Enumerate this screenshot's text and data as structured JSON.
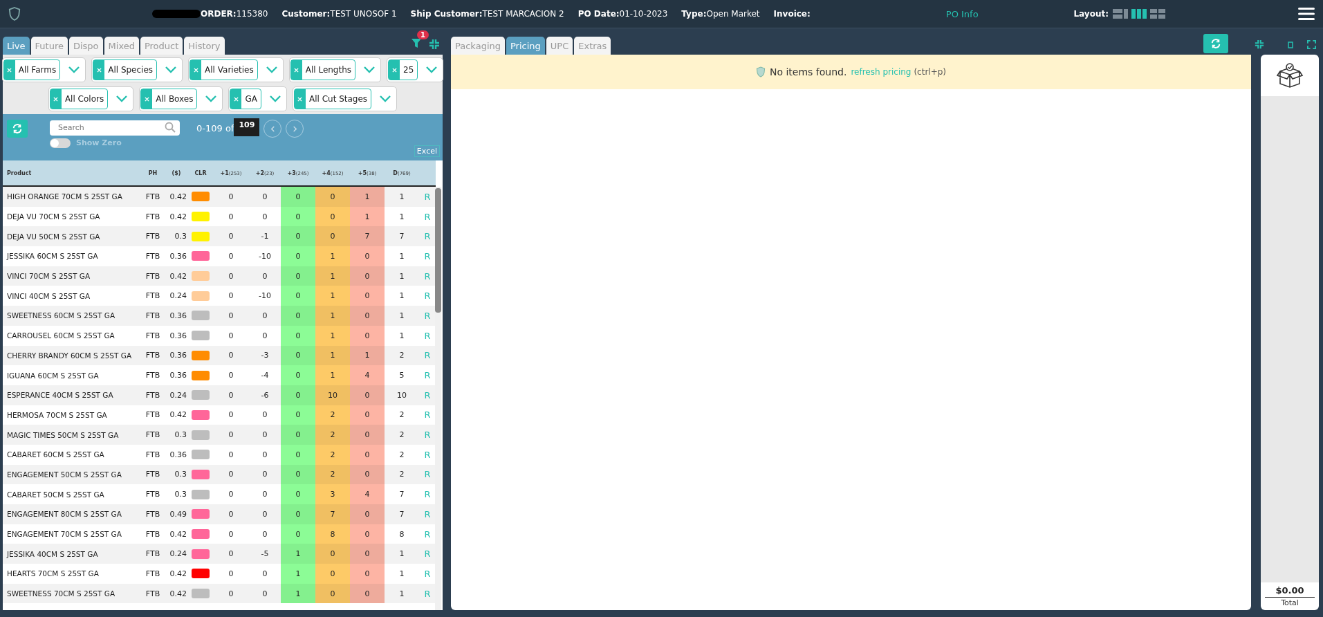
{
  "header": {
    "fields": [
      {
        "label": "ORDER:",
        "value": "115380"
      },
      {
        "label": "Customer:",
        "value": "TEST UNOSOF 1"
      },
      {
        "label": "Ship Customer:",
        "value": "TEST MARCACION 2"
      },
      {
        "label": "PO Date:",
        "value": "01-10-2023"
      },
      {
        "label": "Type:",
        "value": "Open Market"
      },
      {
        "label": "Invoice:"
      }
    ],
    "po_info": "PO Info",
    "layout_label": "Layout:",
    "layouts": [
      {
        "selected": false
      },
      {
        "selected": true
      },
      {
        "selected": false
      }
    ]
  },
  "left": {
    "tabs": [
      {
        "label": "Live",
        "selected": true
      },
      {
        "label": "Future",
        "selected": false
      },
      {
        "label": "Dispo",
        "selected": false
      },
      {
        "label": "Mixed",
        "selected": false
      },
      {
        "label": "Product",
        "selected": false
      },
      {
        "label": "History",
        "selected": false
      }
    ],
    "filter_badge": "1",
    "filters": [
      [
        "All Farms",
        "All Species",
        "All Varieties",
        "All Lengths",
        "25"
      ],
      [
        "All Colors",
        "All Boxes",
        "GA",
        "All Cut Stages"
      ]
    ],
    "search": {
      "placeholder": "Search"
    },
    "range": "0-109 of",
    "total": "109",
    "show_zero": {
      "label": "Show Zero",
      "on": false
    },
    "excel": "Excel",
    "columns": [
      {
        "label": "Product"
      },
      {
        "label": "PH"
      },
      {
        "label": "($)"
      },
      {
        "label": "CLR"
      },
      {
        "label": "+1",
        "count": "(253)"
      },
      {
        "label": "+2",
        "count": "(23)"
      },
      {
        "label": "+3",
        "count": "(245)"
      },
      {
        "label": "+4",
        "count": "(152)"
      },
      {
        "label": "+5",
        "count": "(38)"
      },
      {
        "label": "D",
        "count": "(769)"
      }
    ],
    "rows": [
      {
        "product": "HIGH ORANGE 70CM S 25ST GA",
        "ph": "FTB",
        "price": "0.42",
        "color": "#ff8c00",
        "d1": "0",
        "d2": "0",
        "d3": "0",
        "d4": "0",
        "d5": "1",
        "d": "1",
        "action": "R"
      },
      {
        "product": "DEJA VU 70CM S 25ST GA",
        "ph": "FTB",
        "price": "0.42",
        "color": "#fff200",
        "d1": "0",
        "d2": "0",
        "d3": "0",
        "d4": "0",
        "d5": "1",
        "d": "1",
        "action": "R"
      },
      {
        "product": "DEJA VU 50CM S 25ST GA",
        "ph": "FTB",
        "price": "0.3",
        "color": "#fff200",
        "d1": "0",
        "d2": "-1",
        "d3": "0",
        "d4": "0",
        "d5": "7",
        "d": "7",
        "action": "R"
      },
      {
        "product": "JESSIKA 60CM S 25ST GA",
        "ph": "FTB",
        "price": "0.36",
        "color": "#ff6699",
        "d1": "0",
        "d2": "-10",
        "d3": "0",
        "d4": "1",
        "d5": "0",
        "d": "1",
        "action": "R"
      },
      {
        "product": "VINCI 70CM S 25ST GA",
        "ph": "FTB",
        "price": "0.42",
        "color": "#ffcc99",
        "d1": "0",
        "d2": "0",
        "d3": "0",
        "d4": "1",
        "d5": "0",
        "d": "1",
        "action": "R"
      },
      {
        "product": "VINCI 40CM S 25ST GA",
        "ph": "FTB",
        "price": "0.24",
        "color": "#ffcc99",
        "d1": "0",
        "d2": "-10",
        "d3": "0",
        "d4": "1",
        "d5": "0",
        "d": "1",
        "action": "R"
      },
      {
        "product": "SWEETNESS 60CM S 25ST GA",
        "ph": "FTB",
        "price": "0.36",
        "color": "#bdbdbd",
        "d1": "0",
        "d2": "0",
        "d3": "0",
        "d4": "1",
        "d5": "0",
        "d": "1",
        "action": "R"
      },
      {
        "product": "CARROUSEL 60CM S 25ST GA",
        "ph": "FTB",
        "price": "0.36",
        "color": "#bdbdbd",
        "d1": "0",
        "d2": "0",
        "d3": "0",
        "d4": "1",
        "d5": "0",
        "d": "1",
        "action": "R"
      },
      {
        "product": "CHERRY BRANDY 60CM S 25ST GA",
        "ph": "FTB",
        "price": "0.36",
        "color": "#ff8c00",
        "d1": "0",
        "d2": "-3",
        "d3": "0",
        "d4": "1",
        "d5": "1",
        "d": "2",
        "action": "R"
      },
      {
        "product": "IGUANA 60CM S 25ST GA",
        "ph": "FTB",
        "price": "0.36",
        "color": "#ff8c00",
        "d1": "0",
        "d2": "-4",
        "d3": "0",
        "d4": "1",
        "d5": "4",
        "d": "5",
        "action": "R"
      },
      {
        "product": "ESPERANCE 40CM S 25ST GA",
        "ph": "FTB",
        "price": "0.24",
        "color": "#bdbdbd",
        "d1": "0",
        "d2": "-6",
        "d3": "0",
        "d4": "10",
        "d5": "0",
        "d": "10",
        "action": "R"
      },
      {
        "product": "HERMOSA 70CM S 25ST GA",
        "ph": "FTB",
        "price": "0.42",
        "color": "#ff6699",
        "d1": "0",
        "d2": "0",
        "d3": "0",
        "d4": "2",
        "d5": "0",
        "d": "2",
        "action": "R"
      },
      {
        "product": "MAGIC TIMES 50CM S 25ST GA",
        "ph": "FTB",
        "price": "0.3",
        "color": "#bdbdbd",
        "d1": "0",
        "d2": "0",
        "d3": "0",
        "d4": "2",
        "d5": "0",
        "d": "2",
        "action": "R"
      },
      {
        "product": "CABARET 60CM S 25ST GA",
        "ph": "FTB",
        "price": "0.36",
        "color": "#bdbdbd",
        "d1": "0",
        "d2": "0",
        "d3": "0",
        "d4": "2",
        "d5": "0",
        "d": "2",
        "action": "R"
      },
      {
        "product": "ENGAGEMENT 50CM S 25ST GA",
        "ph": "FTB",
        "price": "0.3",
        "color": "#ff6699",
        "d1": "0",
        "d2": "0",
        "d3": "0",
        "d4": "2",
        "d5": "0",
        "d": "2",
        "action": "R"
      },
      {
        "product": "CABARET 50CM S 25ST GA",
        "ph": "FTB",
        "price": "0.3",
        "color": "#bdbdbd",
        "d1": "0",
        "d2": "0",
        "d3": "0",
        "d4": "3",
        "d5": "4",
        "d": "7",
        "action": "R"
      },
      {
        "product": "ENGAGEMENT 80CM S 25ST GA",
        "ph": "FTB",
        "price": "0.49",
        "color": "#ff6699",
        "d1": "0",
        "d2": "0",
        "d3": "0",
        "d4": "7",
        "d5": "0",
        "d": "7",
        "action": "R"
      },
      {
        "product": "ENGAGEMENT 70CM S 25ST GA",
        "ph": "FTB",
        "price": "0.42",
        "color": "#ff6699",
        "d1": "0",
        "d2": "0",
        "d3": "0",
        "d4": "8",
        "d5": "0",
        "d": "8",
        "action": "R"
      },
      {
        "product": "JESSIKA 40CM S 25ST GA",
        "ph": "FTB",
        "price": "0.24",
        "color": "#ff6699",
        "d1": "0",
        "d2": "-5",
        "d3": "1",
        "d4": "0",
        "d5": "0",
        "d": "1",
        "action": "R"
      },
      {
        "product": "HEARTS 70CM S 25ST GA",
        "ph": "FTB",
        "price": "0.42",
        "color": "#ff0000",
        "d1": "0",
        "d2": "0",
        "d3": "1",
        "d4": "0",
        "d5": "0",
        "d": "1",
        "action": "R"
      },
      {
        "product": "SWEETNESS 70CM S 25ST GA",
        "ph": "FTB",
        "price": "0.42",
        "color": "#bdbdbd",
        "d1": "0",
        "d2": "0",
        "d3": "1",
        "d4": "0",
        "d5": "0",
        "d": "1",
        "action": "R"
      }
    ]
  },
  "right": {
    "tabs": [
      {
        "label": "Packaging",
        "selected": false
      },
      {
        "label": "Pricing",
        "selected": true
      },
      {
        "label": "UPC",
        "selected": false
      },
      {
        "label": "Extras",
        "selected": false
      }
    ],
    "notice": {
      "message": "No items found.",
      "link": "refresh pricing",
      "shortcut": "(ctrl+p)"
    }
  },
  "cart": {
    "total": "$0.00",
    "total_label": "Total"
  }
}
